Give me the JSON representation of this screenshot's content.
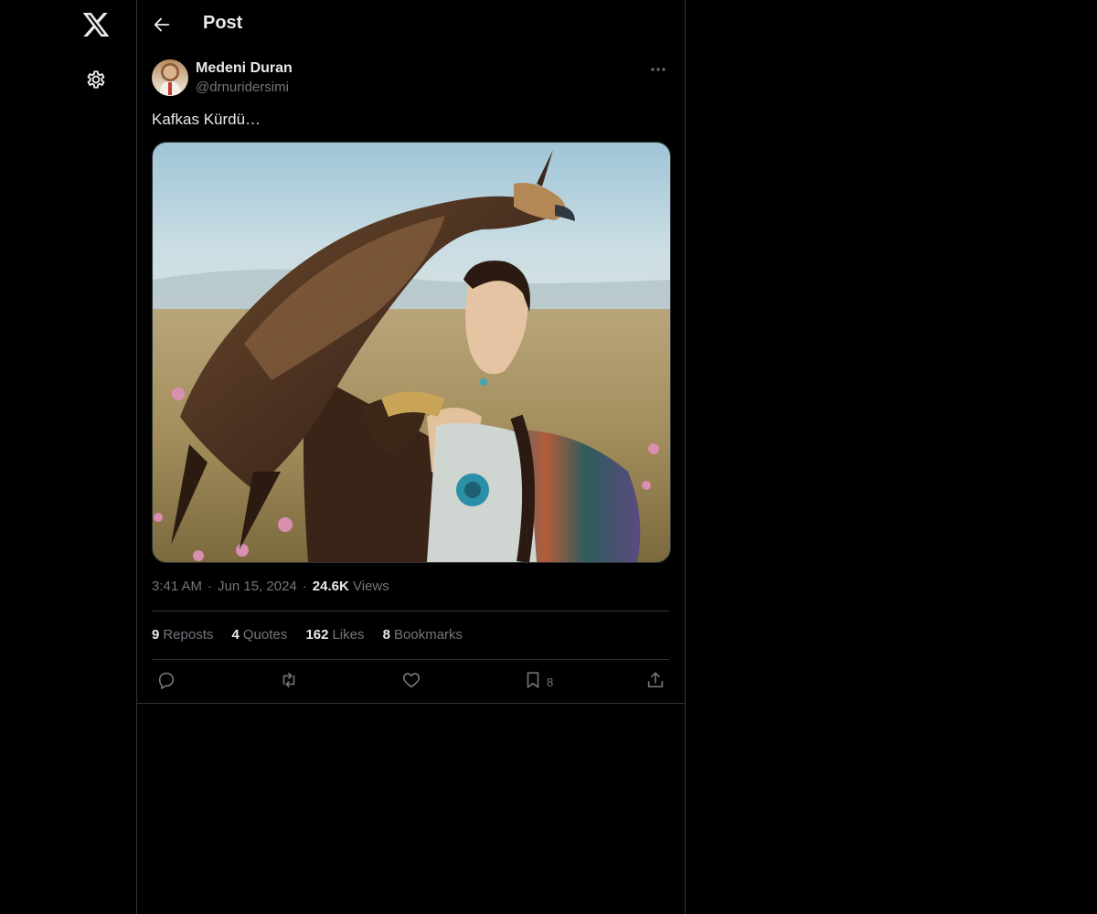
{
  "header": {
    "title": "Post"
  },
  "post": {
    "author_name": "Medeni Duran",
    "author_handle": "@drnuridersimi",
    "text": "Kafkas Kürdü…",
    "time": "3:41 AM",
    "date": "Jun 15, 2024",
    "views_count": "24.6K",
    "views_label": "Views",
    "separator": "·"
  },
  "stats": {
    "reposts_count": "9",
    "reposts_label": "Reposts",
    "quotes_count": "4",
    "quotes_label": "Quotes",
    "likes_count": "162",
    "likes_label": "Likes",
    "bookmarks_count": "8",
    "bookmarks_label": "Bookmarks"
  },
  "actions": {
    "bookmark_count": "8"
  },
  "icons": {
    "logo": "x-logo-icon",
    "settings": "gear-icon",
    "back": "arrow-left-icon",
    "more": "more-horizontal-icon",
    "reply": "reply-icon",
    "repost": "repost-icon",
    "like": "heart-icon",
    "bookmark": "bookmark-icon",
    "share": "share-icon"
  },
  "colors": {
    "background": "#000000",
    "text_primary": "#e7e9ea",
    "text_secondary": "#71767b",
    "border": "#2f3336"
  }
}
